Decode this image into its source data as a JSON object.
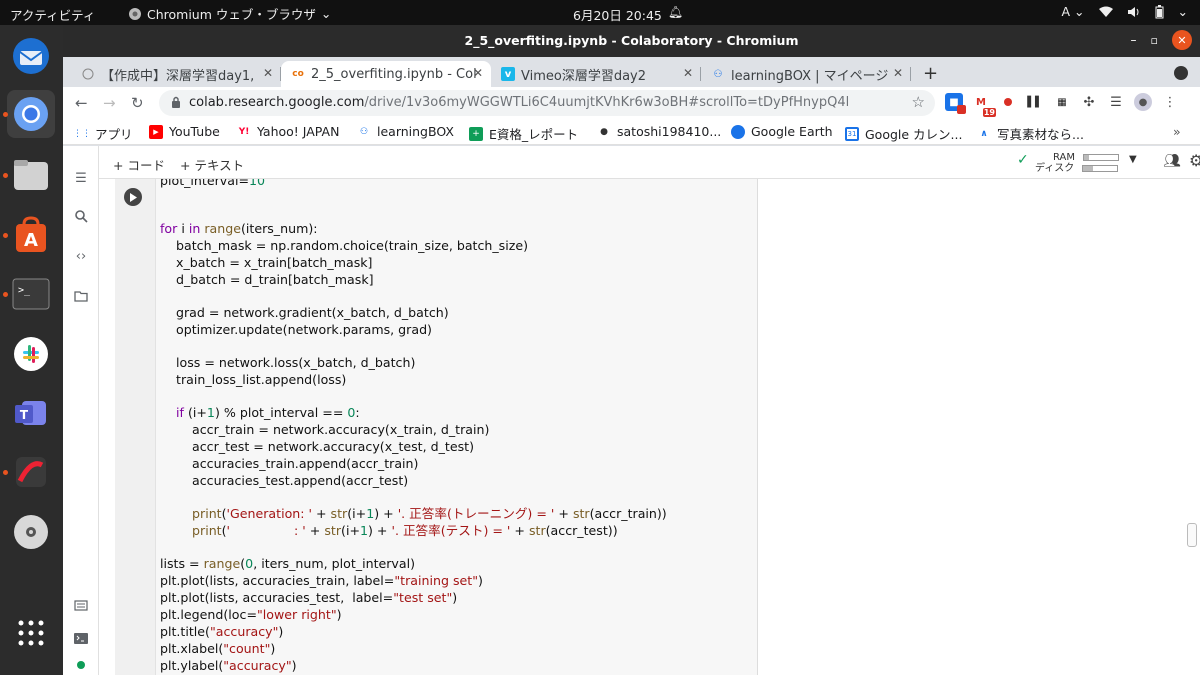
{
  "topbar": {
    "activities": "アクティビティ",
    "app_name": "Chromium ウェブ・ブラウザ",
    "clock": "6月20日  20:45",
    "input_method": "A"
  },
  "window": {
    "title": "2_5_overfiting.ipynb - Colaboratory - Chromium"
  },
  "tabs": [
    {
      "label": "【作成中】深層学習day1,",
      "icon": "doc-icon"
    },
    {
      "label": "2_5_overfiting.ipynb - Col",
      "icon": "colab-icon"
    },
    {
      "label": "Vimeo深層学習day2",
      "icon": "vimeo-icon"
    },
    {
      "label": "learningBOX | マイページ",
      "icon": "learningbox-icon"
    }
  ],
  "omnibox": {
    "host": "colab.research.google.com",
    "path": "/drive/1v3o6myWGGWTLi6C4uumjtKVhKr6w3oBH#scrollTo=tDyPfHnypQ4l"
  },
  "extensions": {
    "gmail_badge": "19"
  },
  "bookmarks": [
    {
      "label": "アプリ",
      "icon": "apps-grid-icon"
    },
    {
      "label": "YouTube",
      "icon": "youtube-icon"
    },
    {
      "label": "Yahoo! JAPAN",
      "icon": "yahoo-icon"
    },
    {
      "label": "learningBOX",
      "icon": "learningbox-icon"
    },
    {
      "label": "E資格_レポート",
      "icon": "sheets-icon"
    },
    {
      "label": "satoshi198410...",
      "icon": "github-icon"
    },
    {
      "label": "Google Earth",
      "icon": "earth-icon"
    },
    {
      "label": "Google カレン...",
      "icon": "calendar-icon"
    },
    {
      "label": "写真素材なら...",
      "icon": "photo-icon"
    }
  ],
  "colab": {
    "add_code": "+ コード",
    "add_text": "+ テキスト",
    "ram_label": "RAM",
    "disk_label": "ディスク",
    "ram_fraction": 0.15,
    "disk_fraction": 0.3
  },
  "code_lines": {
    "l00": "plot_interval=10",
    "l01": "for i in range(iters_num):",
    "l02": "    batch_mask = np.random.choice(train_size, batch_size)",
    "l03": "    x_batch = x_train[batch_mask]",
    "l04": "    d_batch = d_train[batch_mask]",
    "l05": "    grad = network.gradient(x_batch, d_batch)",
    "l06": "    optimizer.update(network.params, grad)",
    "l07": "    loss = network.loss(x_batch, d_batch)",
    "l08": "    train_loss_list.append(loss)",
    "l09": "    if (i+1) % plot_interval == 0:",
    "l10": "        accr_train = network.accuracy(x_train, d_train)",
    "l11": "        accr_test = network.accuracy(x_test, d_test)",
    "l12": "        accuracies_train.append(accr_train)",
    "l13": "        accuracies_test.append(accr_test)",
    "l14": "        print('Generation: ' + str(i+1) + '. 正答率(トレーニング) = ' + str(accr_train))",
    "l15": "        print('                : ' + str(i+1) + '. 正答率(テスト) = ' + str(accr_test))",
    "l16": "lists = range(0, iters_num, plot_interval)",
    "l17": "plt.plot(lists, accuracies_train, label=\"training set\")",
    "l18": "plt.plot(lists, accuracies_test,  label=\"test set\")",
    "l19": "plt.legend(loc=\"lower right\")",
    "l20": "plt.title(\"accuracy\")",
    "l21": "plt.xlabel(\"count\")",
    "l22": "plt.ylabel(\"accuracy\")"
  }
}
